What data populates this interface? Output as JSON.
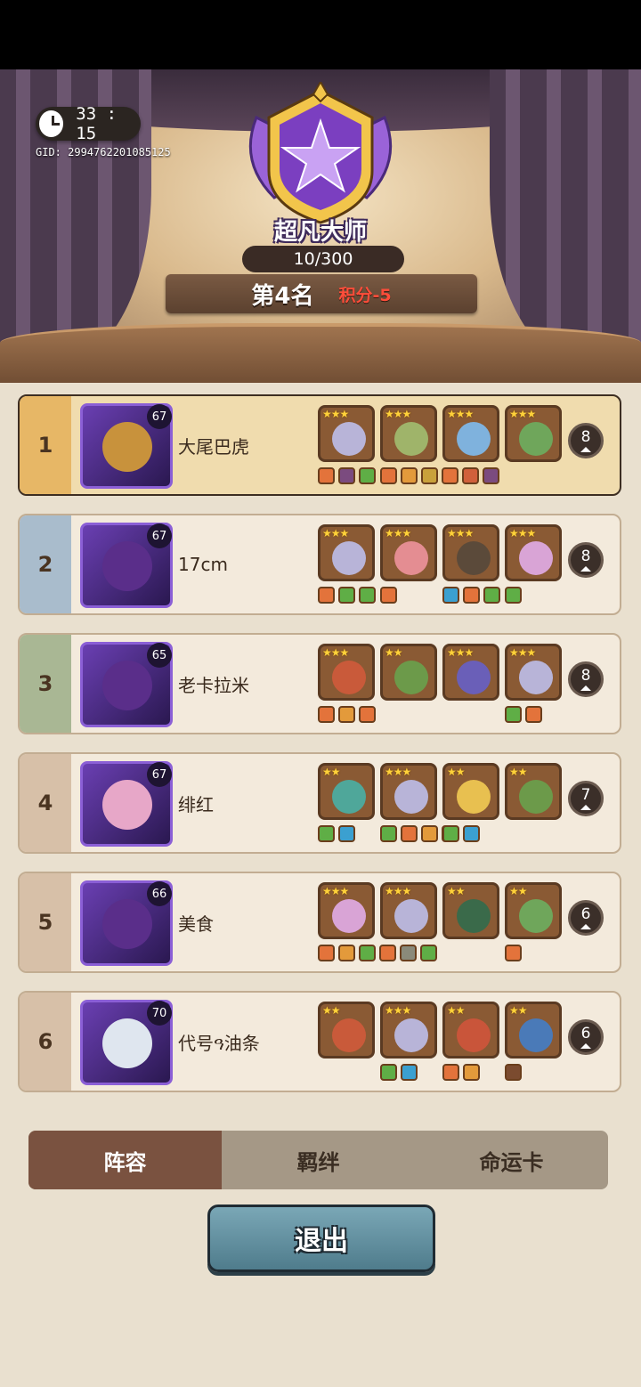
{
  "header": {
    "timer": "33 : 15",
    "gid": "GID: 2994762201085125",
    "rank_title": "超凡大师",
    "rank_progress": "10/300",
    "placement": "第4名",
    "score": "积分-5"
  },
  "players": [
    {
      "rank": "1",
      "name": "大尾巴虎",
      "level": "67",
      "population": "8",
      "strip_color": "#e7b766",
      "avatar_color": "#c8923c",
      "heroes": [
        {
          "stars": "★★★",
          "color": "#b8b4d8"
        },
        {
          "stars": "★★★",
          "color": "#9fb46a"
        },
        {
          "stars": "★★★",
          "color": "#7fb2dd"
        },
        {
          "stars": "★★★",
          "color": "#6fa65b"
        }
      ],
      "items": [
        {
          "col": 0,
          "pos": 0,
          "color": "#e3733b"
        },
        {
          "col": 0,
          "pos": 1,
          "color": "#7b4b7f"
        },
        {
          "col": 0,
          "pos": 2,
          "color": "#5fae46"
        },
        {
          "col": 1,
          "pos": 0,
          "color": "#e3733b"
        },
        {
          "col": 1,
          "pos": 1,
          "color": "#e39a3b"
        },
        {
          "col": 1,
          "pos": 2,
          "color": "#c9a13b"
        },
        {
          "col": 1,
          "pos": 3,
          "color": "#e3733b"
        },
        {
          "col": 1,
          "pos": 4,
          "color": "#d0603b"
        },
        {
          "col": 1,
          "pos": 5,
          "color": "#7b4b7f"
        }
      ]
    },
    {
      "rank": "2",
      "name": "17cm",
      "level": "67",
      "population": "8",
      "strip_color": "#a9bccc",
      "avatar_color": "#5a2e8a",
      "heroes": [
        {
          "stars": "★★★",
          "color": "#b8b4d8"
        },
        {
          "stars": "★★★",
          "color": "#e48d92"
        },
        {
          "stars": "★★★",
          "color": "#5b4a3a"
        },
        {
          "stars": "★★★",
          "color": "#d9a4d6"
        }
      ],
      "items": [
        {
          "col": 0,
          "pos": 0,
          "color": "#e3733b"
        },
        {
          "col": 0,
          "pos": 1,
          "color": "#5fae46"
        },
        {
          "col": 0,
          "pos": 2,
          "color": "#5fae46"
        },
        {
          "col": 1,
          "pos": 0,
          "color": "#e3733b"
        },
        {
          "col": 2,
          "pos": 0,
          "color": "#3ba0d0"
        },
        {
          "col": 2,
          "pos": 1,
          "color": "#e3733b"
        },
        {
          "col": 2,
          "pos": 2,
          "color": "#5fae46"
        },
        {
          "col": 3,
          "pos": 0,
          "color": "#5fae46"
        }
      ]
    },
    {
      "rank": "3",
      "name": "老卡拉米",
      "level": "65",
      "population": "8",
      "strip_color": "#a9b794",
      "avatar_color": "#5a2e8a",
      "heroes": [
        {
          "stars": "★★★",
          "color": "#c95a3a"
        },
        {
          "stars": "★★",
          "color": "#6c9a4a"
        },
        {
          "stars": "★★★",
          "color": "#6a5fb8"
        },
        {
          "stars": "★★★",
          "color": "#b8b4d8"
        }
      ],
      "items": [
        {
          "col": 0,
          "pos": 0,
          "color": "#e3733b"
        },
        {
          "col": 0,
          "pos": 1,
          "color": "#e39a3b"
        },
        {
          "col": 0,
          "pos": 2,
          "color": "#e3733b"
        },
        {
          "col": 3,
          "pos": 0,
          "color": "#5fae46"
        },
        {
          "col": 3,
          "pos": 1,
          "color": "#e3733b"
        }
      ]
    },
    {
      "rank": "4",
      "name": "绯红",
      "level": "67",
      "population": "7",
      "strip_color": "#d7c0a8",
      "avatar_color": "#e7a7c8",
      "heroes": [
        {
          "stars": "★★",
          "color": "#4fa79a"
        },
        {
          "stars": "★★★",
          "color": "#b8b4d8"
        },
        {
          "stars": "★★",
          "color": "#e8c050"
        },
        {
          "stars": "★★",
          "color": "#6c9a4a"
        }
      ],
      "items": [
        {
          "col": 0,
          "pos": 0,
          "color": "#5fae46"
        },
        {
          "col": 0,
          "pos": 1,
          "color": "#3ba0d0"
        },
        {
          "col": 1,
          "pos": 0,
          "color": "#5fae46"
        },
        {
          "col": 1,
          "pos": 1,
          "color": "#e3733b"
        },
        {
          "col": 1,
          "pos": 2,
          "color": "#e39a3b"
        },
        {
          "col": 1,
          "pos": 3,
          "color": "#3ba0d0"
        },
        {
          "col": 2,
          "pos": 0,
          "color": "#5fae46"
        },
        {
          "col": 2,
          "pos": 1,
          "color": "#3ba0d0"
        }
      ]
    },
    {
      "rank": "5",
      "name": "美食",
      "level": "66",
      "population": "6",
      "strip_color": "#d7c0a8",
      "avatar_color": "#5a2e8a",
      "heroes": [
        {
          "stars": "★★★",
          "color": "#d9a4d6"
        },
        {
          "stars": "★★★",
          "color": "#b8b4d8"
        },
        {
          "stars": "★★",
          "color": "#3a6a4a"
        },
        {
          "stars": "★★",
          "color": "#6fa65b"
        }
      ],
      "items": [
        {
          "col": 0,
          "pos": 0,
          "color": "#e3733b"
        },
        {
          "col": 0,
          "pos": 1,
          "color": "#e39a3b"
        },
        {
          "col": 0,
          "pos": 2,
          "color": "#5fae46"
        },
        {
          "col": 0,
          "pos": 3,
          "color": "#e3733b"
        },
        {
          "col": 0,
          "pos": 4,
          "color": "#8a8a7a"
        },
        {
          "col": 0,
          "pos": 5,
          "color": "#5fae46"
        },
        {
          "col": 3,
          "pos": 0,
          "color": "#e3733b"
        }
      ]
    },
    {
      "rank": "6",
      "name": "代号ዓ油条",
      "level": "70",
      "population": "6",
      "strip_color": "#d7c0a8",
      "avatar_color": "#dfe6ef",
      "heroes": [
        {
          "stars": "★★",
          "color": "#c95a3a"
        },
        {
          "stars": "★★★",
          "color": "#b8b4d8"
        },
        {
          "stars": "★★",
          "color": "#c9553a"
        },
        {
          "stars": "★★",
          "color": "#4a7ab8"
        }
      ],
      "items": [
        {
          "col": 1,
          "pos": 0,
          "color": "#5fae46"
        },
        {
          "col": 1,
          "pos": 1,
          "color": "#3ba0d0"
        },
        {
          "col": 2,
          "pos": 0,
          "color": "#e3733b"
        },
        {
          "col": 2,
          "pos": 1,
          "color": "#e39a3b"
        },
        {
          "col": 3,
          "pos": 0,
          "color": "#7b4b2f"
        }
      ]
    }
  ],
  "tabs": [
    {
      "label": "阵容",
      "active": true
    },
    {
      "label": "羁绊",
      "active": false
    },
    {
      "label": "命运卡",
      "active": false
    }
  ],
  "exit_label": "退出"
}
